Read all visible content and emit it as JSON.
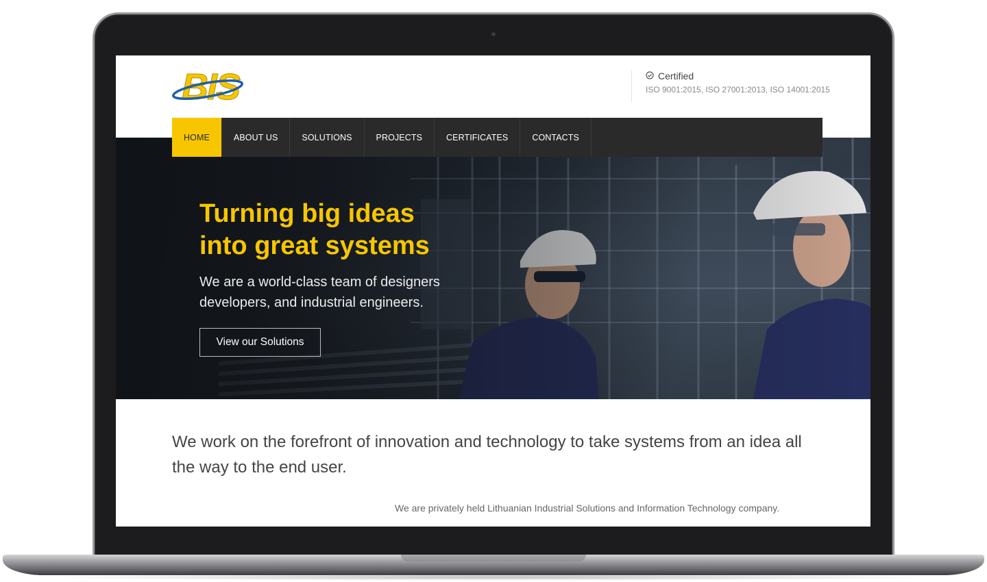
{
  "brand": {
    "logo_text": "BIS",
    "colors": {
      "accent": "#f7c600",
      "nav_bg": "#2a2a2b",
      "logo_blue": "#1f5fa8"
    }
  },
  "certification": {
    "icon": "check-circle-icon",
    "title": "Certified",
    "standards": "ISO 9001:2015, ISO 27001:2013, ISO 14001:2015"
  },
  "nav": {
    "items": [
      {
        "label": "HOME",
        "active": true
      },
      {
        "label": "ABOUT US",
        "active": false
      },
      {
        "label": "SOLUTIONS",
        "active": false
      },
      {
        "label": "PROJECTS",
        "active": false
      },
      {
        "label": "CERTIFICATES",
        "active": false
      },
      {
        "label": "CONTACTS",
        "active": false
      }
    ]
  },
  "hero": {
    "title_line1": "Turning big ideas",
    "title_line2": "into great systems",
    "subtitle_line1": "We are a world-class team of designers",
    "subtitle_line2": "developers, and industrial engineers.",
    "cta_label": "View our Solutions"
  },
  "intro": {
    "lead": "We work on the forefront of innovation and technology to take systems from an idea all the way to the end user.",
    "note": "We are privately held Lithuanian Industrial Solutions and Information Technology company."
  }
}
